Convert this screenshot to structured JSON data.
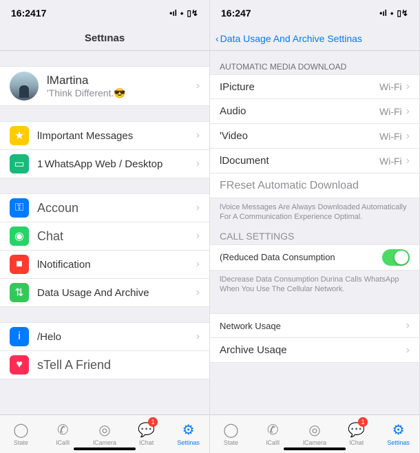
{
  "left": {
    "status": {
      "time": "16:2417",
      "signal": "•ıl",
      "wifi": "⬩",
      "battery": "▢▸"
    },
    "nav": {
      "title": "Settınas"
    },
    "profile": {
      "name": "lMartina",
      "status": "'Think Different.😎"
    },
    "items": {
      "important": "lImportant Messages",
      "webdesktop": "1 WhatsApp Web / Desktop",
      "account": "Accoun",
      "chat": "Chat",
      "notification": "lNotification",
      "data": "Data Usage And Archive",
      "help": "/Helo",
      "tell": "sTell A Friend"
    }
  },
  "right": {
    "status": {
      "time": "16:247",
      "signal": "•ıl",
      "wifi": "⬩",
      "battery": "▢▸"
    },
    "nav": {
      "back": "Data Usage And Archive Settinas"
    },
    "sections": {
      "media_header": "AUTOMATIC MEDIA DOWNLOAD",
      "picture": {
        "label": "IPicture",
        "value": "Wi-Fi"
      },
      "audio": {
        "label": "Audio",
        "value": "Wi-Fi"
      },
      "video": {
        "label": "'Video",
        "value": "Wi-Fi"
      },
      "document": {
        "label": "lDocument",
        "value": "Wi-Fi"
      },
      "reset": "FReset Automatic Download",
      "media_footer": "lVoice Messages Are Always Downloaded Automatically For A Communication Experience Optimal.",
      "call_header": "CALL SETTINGS",
      "reduced": "(Reduced Data Consumption",
      "call_footer": "lDecrease Data Consumption Durina Calls WhatsApp When You Use The Cellular Network.",
      "network": "Network Usaqe",
      "archive": "Archive Usaqe"
    }
  },
  "tabs": {
    "state": "State",
    "call": "lCalll",
    "camera": "lCamera",
    "chat": "lChat",
    "chat_badge": "1",
    "settings": "Settinas"
  }
}
